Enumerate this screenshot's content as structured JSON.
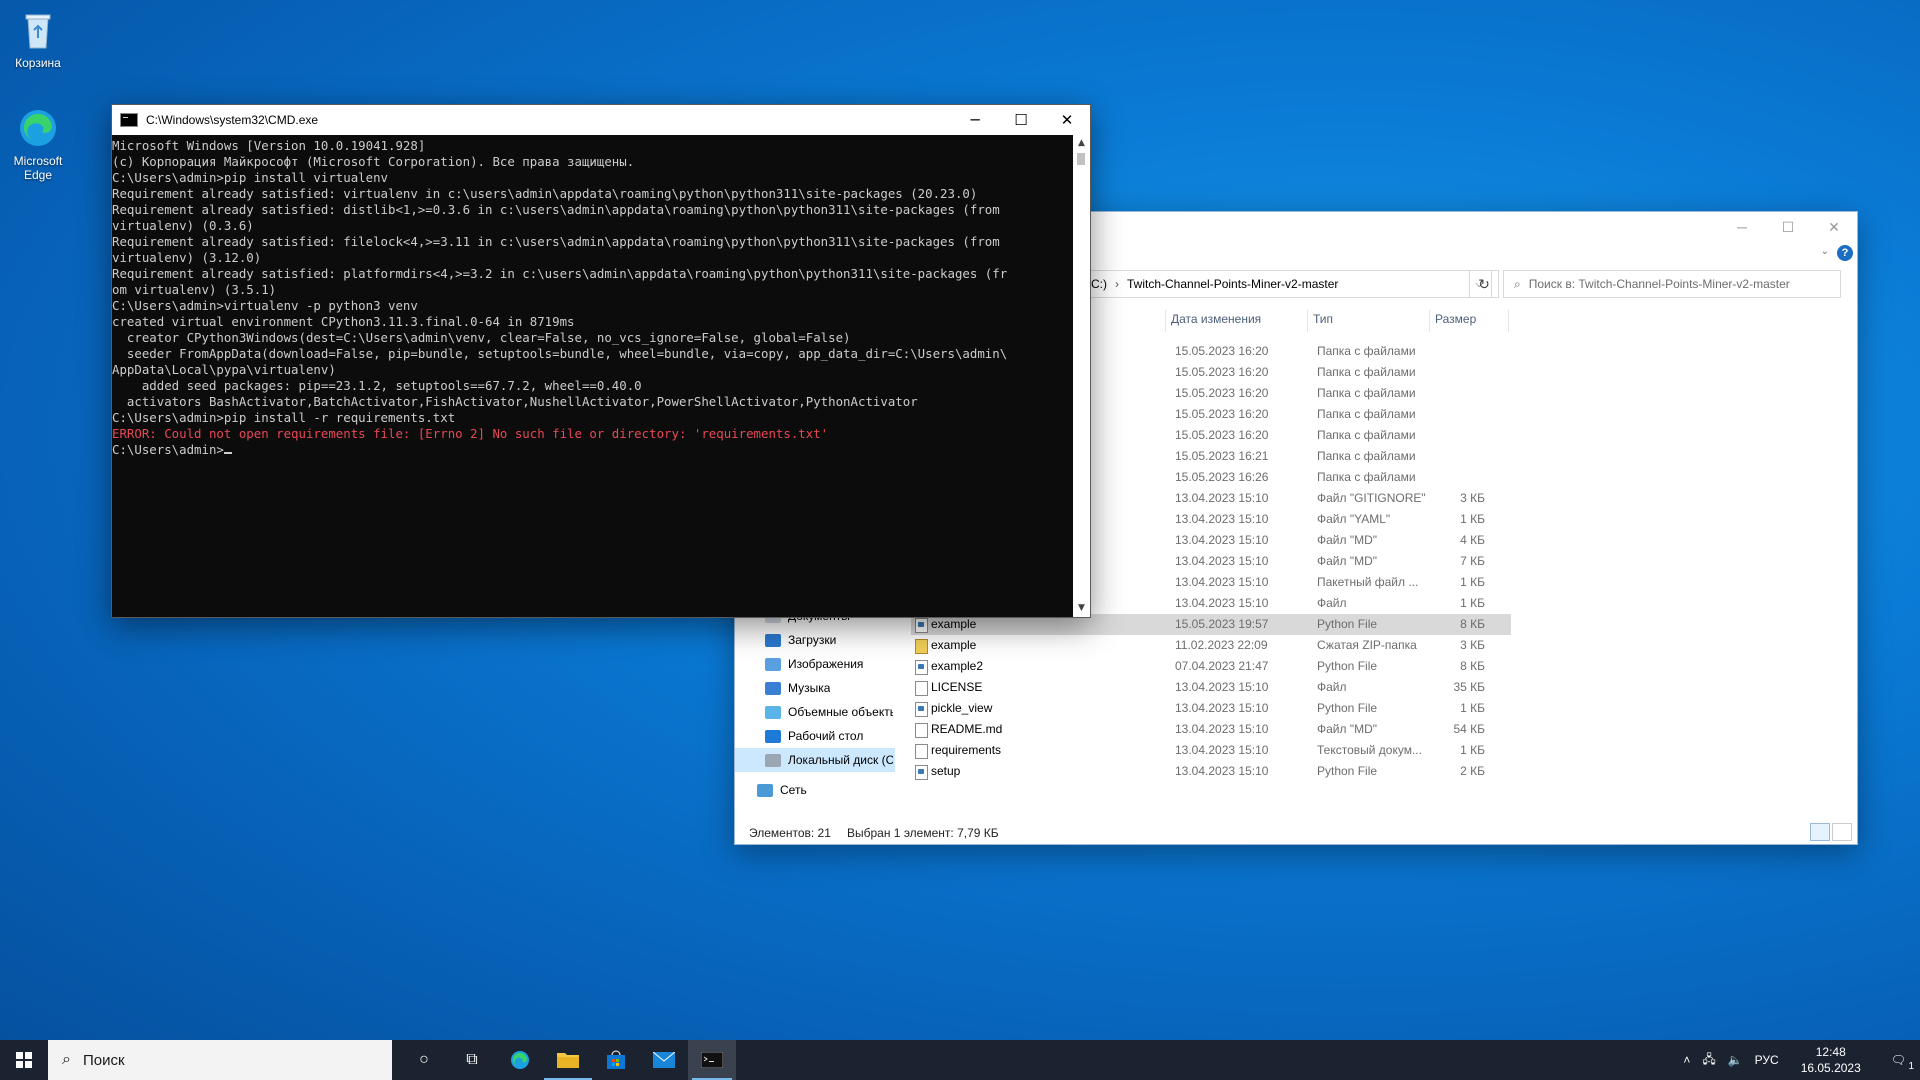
{
  "desktop": {
    "icons": [
      {
        "label": "Корзина",
        "icon": "recycle-bin-icon"
      },
      {
        "label": "Microsoft Edge",
        "icon": "edge-icon"
      }
    ]
  },
  "cmd": {
    "title": "C:\\Windows\\system32\\CMD.exe",
    "lines": [
      "Microsoft Windows [Version 10.0.19041.928]",
      "(c) Корпорация Майкрософт (Microsoft Corporation). Все права защищены.",
      "",
      "C:\\Users\\admin>pip install virtualenv",
      "Requirement already satisfied: virtualenv in c:\\users\\admin\\appdata\\roaming\\python\\python311\\site-packages (20.23.0)",
      "Requirement already satisfied: distlib<1,>=0.3.6 in c:\\users\\admin\\appdata\\roaming\\python\\python311\\site-packages (from",
      "virtualenv) (0.3.6)",
      "Requirement already satisfied: filelock<4,>=3.11 in c:\\users\\admin\\appdata\\roaming\\python\\python311\\site-packages (from",
      "virtualenv) (3.12.0)",
      "Requirement already satisfied: platformdirs<4,>=3.2 in c:\\users\\admin\\appdata\\roaming\\python\\python311\\site-packages (fr",
      "om virtualenv) (3.5.1)",
      "",
      "C:\\Users\\admin>virtualenv -p python3 venv",
      "created virtual environment CPython3.11.3.final.0-64 in 8719ms",
      "  creator CPython3Windows(dest=C:\\Users\\admin\\venv, clear=False, no_vcs_ignore=False, global=False)",
      "  seeder FromAppData(download=False, pip=bundle, setuptools=bundle, wheel=bundle, via=copy, app_data_dir=C:\\Users\\admin\\",
      "AppData\\Local\\pypa\\virtualenv)",
      "    added seed packages: pip==23.1.2, setuptools==67.7.2, wheel==0.40.0",
      "  activators BashActivator,BatchActivator,FishActivator,NushellActivator,PowerShellActivator,PythonActivator",
      "",
      "C:\\Users\\admin>pip install -r requirements.txt"
    ],
    "error_line": "ERROR: Could not open requirements file: [Errno 2] No such file or directory: 'requirements.txt'",
    "prompt": "C:\\Users\\admin>",
    "colors": {
      "bg": "#0c0c0c",
      "text": "#cccccc",
      "error": "#e74856"
    }
  },
  "explorer": {
    "address_drive": "C:)",
    "address_separator": "›",
    "address_folder": "Twitch-Channel-Points-Miner-v2-master",
    "search_placeholder": "Поиск в: Twitch-Channel-Points-Miner-v2-master",
    "columns": {
      "date": "Дата изменения",
      "type": "Тип",
      "size": "Размер"
    },
    "rows": [
      {
        "name": "",
        "date": "15.05.2023 16:20",
        "type": "Папка с файлами",
        "size": "",
        "icon": "folder-icon"
      },
      {
        "name": "",
        "date": "15.05.2023 16:20",
        "type": "Папка с файлами",
        "size": "",
        "icon": "folder-icon"
      },
      {
        "name": "",
        "date": "15.05.2023 16:20",
        "type": "Папка с файлами",
        "size": "",
        "icon": "folder-icon"
      },
      {
        "name": "",
        "date": "15.05.2023 16:20",
        "type": "Папка с файлами",
        "size": "",
        "icon": "folder-icon"
      },
      {
        "name": "",
        "date": "15.05.2023 16:20",
        "type": "Папка с файлами",
        "size": "",
        "icon": "folder-icon"
      },
      {
        "name": "",
        "date": "15.05.2023 16:21",
        "type": "Папка с файлами",
        "size": "",
        "icon": "folder-icon"
      },
      {
        "name": "",
        "date": "15.05.2023 16:26",
        "type": "Папка с файлами",
        "size": "",
        "icon": "folder-icon"
      },
      {
        "name": "",
        "date": "13.04.2023 15:10",
        "type": "Файл \"GITIGNORE\"",
        "size": "3 КБ",
        "icon": "file-icon"
      },
      {
        "name": "",
        "date": "13.04.2023 15:10",
        "type": "Файл \"YAML\"",
        "size": "1 КБ",
        "icon": "file-icon"
      },
      {
        "name": "",
        "date": "13.04.2023 15:10",
        "type": "Файл \"MD\"",
        "size": "4 КБ",
        "icon": "file-icon"
      },
      {
        "name": "",
        "date": "13.04.2023 15:10",
        "type": "Файл \"MD\"",
        "size": "7 КБ",
        "icon": "file-icon"
      },
      {
        "name": "",
        "date": "13.04.2023 15:10",
        "type": "Пакетный файл ...",
        "size": "1 КБ",
        "icon": "file-icon"
      },
      {
        "name": "",
        "date": "13.04.2023 15:10",
        "type": "Файл",
        "size": "1 КБ",
        "icon": "file-icon"
      },
      {
        "name": "example",
        "date": "15.05.2023 19:57",
        "type": "Python File",
        "size": "8 КБ",
        "icon": "python-file-icon",
        "selected": true
      },
      {
        "name": "example",
        "date": "11.02.2023 22:09",
        "type": "Сжатая ZIP-папка",
        "size": "3 КБ",
        "icon": "zip-icon"
      },
      {
        "name": "example2",
        "date": "07.04.2023 21:47",
        "type": "Python File",
        "size": "8 КБ",
        "icon": "python-file-icon"
      },
      {
        "name": "LICENSE",
        "date": "13.04.2023 15:10",
        "type": "Файл",
        "size": "35 КБ",
        "icon": "file-icon"
      },
      {
        "name": "pickle_view",
        "date": "13.04.2023 15:10",
        "type": "Python File",
        "size": "1 КБ",
        "icon": "python-file-icon"
      },
      {
        "name": "README.md",
        "date": "13.04.2023 15:10",
        "type": "Файл \"MD\"",
        "size": "54 КБ",
        "icon": "file-icon"
      },
      {
        "name": "requirements",
        "date": "13.04.2023 15:10",
        "type": "Текстовый докум...",
        "size": "1 КБ",
        "icon": "text-file-icon"
      },
      {
        "name": "setup",
        "date": "13.04.2023 15:10",
        "type": "Python File",
        "size": "2 КБ",
        "icon": "python-file-icon"
      }
    ],
    "nav": [
      {
        "label": "Документы",
        "icon": "documents-icon"
      },
      {
        "label": "Загрузки",
        "icon": "downloads-icon"
      },
      {
        "label": "Изображения",
        "icon": "pictures-icon"
      },
      {
        "label": "Музыка",
        "icon": "music-icon"
      },
      {
        "label": "Объемные объекты",
        "icon": "3d-objects-icon"
      },
      {
        "label": "Рабочий стол",
        "icon": "desktop-icon"
      },
      {
        "label": "Локальный диск (C:)",
        "icon": "drive-icon",
        "selected": true
      },
      {
        "label": "Сеть",
        "icon": "network-icon"
      }
    ],
    "status_count": "Элементов: 21",
    "status_selection": "Выбран 1 элемент: 7,79 КБ"
  },
  "taskbar": {
    "search_placeholder": "Поиск",
    "language": "РУС",
    "time": "12:48",
    "date": "16.05.2023",
    "notification_count": "1"
  }
}
